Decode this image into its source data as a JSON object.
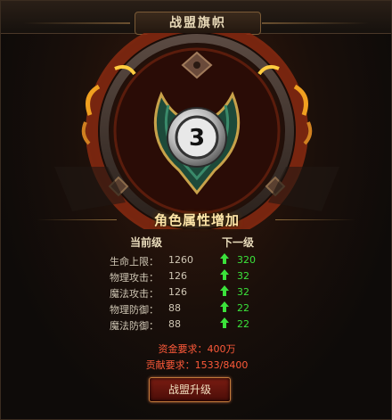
{
  "window": {
    "title": "战盟旗帜"
  },
  "badge": {
    "level": "3"
  },
  "section": {
    "title": "角色属性增加"
  },
  "columns": {
    "current": "当前级",
    "next": "下一级"
  },
  "stats": [
    {
      "label": "生命上限：",
      "current": "1260",
      "next": "320"
    },
    {
      "label": "物理攻击：",
      "current": "126",
      "next": "32"
    },
    {
      "label": "魔法攻击：",
      "current": "126",
      "next": "32"
    },
    {
      "label": "物理防御：",
      "current": "88",
      "next": "22"
    },
    {
      "label": "魔法防御：",
      "current": "88",
      "next": "22"
    }
  ],
  "requirements": {
    "gold": "资金要求：400万",
    "contribution": "贡献要求：1533/8400"
  },
  "button": {
    "upgrade": "战盟升级"
  },
  "colors": {
    "accent": "#e8b040",
    "next_value": "#3be23b",
    "requirement": "#ff5a3a"
  }
}
